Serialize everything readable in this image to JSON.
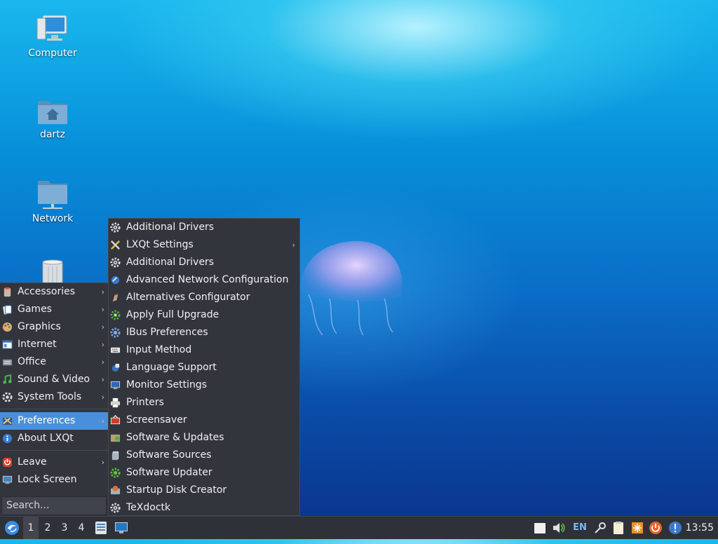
{
  "desktop": {
    "icons": [
      {
        "label": "Computer",
        "icon": "computer-icon"
      },
      {
        "label": "dartz",
        "icon": "home-folder-icon"
      },
      {
        "label": "Network",
        "icon": "network-folder-icon"
      },
      {
        "label": "",
        "icon": "trash-icon"
      }
    ]
  },
  "main_menu": {
    "categories": [
      {
        "label": "Accessories",
        "icon": "accessories-icon",
        "submenu": true
      },
      {
        "label": "Games",
        "icon": "games-icon",
        "submenu": true
      },
      {
        "label": "Graphics",
        "icon": "graphics-icon",
        "submenu": true
      },
      {
        "label": "Internet",
        "icon": "internet-icon",
        "submenu": true
      },
      {
        "label": "Office",
        "icon": "office-icon",
        "submenu": true
      },
      {
        "label": "Sound & Video",
        "icon": "sound-video-icon",
        "submenu": true
      },
      {
        "label": "System Tools",
        "icon": "system-tools-icon",
        "submenu": true
      }
    ],
    "preferences": {
      "label": "Preferences",
      "icon": "preferences-icon",
      "submenu": true,
      "active": true
    },
    "about": {
      "label": "About LXQt",
      "icon": "info-icon"
    },
    "leave": {
      "label": "Leave",
      "icon": "leave-icon",
      "submenu": true
    },
    "lock": {
      "label": "Lock Screen",
      "icon": "lock-screen-icon"
    },
    "search_placeholder": "Search..."
  },
  "preferences_menu": {
    "items": [
      {
        "label": "Additional Drivers",
        "icon": "gear-icon"
      },
      {
        "label": "LXQt Settings",
        "icon": "tools-icon",
        "submenu": true
      },
      {
        "label": "Additional Drivers",
        "icon": "gear-icon"
      },
      {
        "label": "Advanced Network Configuration",
        "icon": "network-config-icon"
      },
      {
        "label": "Alternatives Configurator",
        "icon": "alternatives-icon"
      },
      {
        "label": "Apply Full Upgrade",
        "icon": "upgrade-gear-icon"
      },
      {
        "label": "IBus Preferences",
        "icon": "ibus-gear-icon"
      },
      {
        "label": "Input Method",
        "icon": "keyboard-icon"
      },
      {
        "label": "Language Support",
        "icon": "language-icon"
      },
      {
        "label": "Monitor Settings",
        "icon": "monitor-icon"
      },
      {
        "label": "Printers",
        "icon": "printer-icon"
      },
      {
        "label": "Screensaver",
        "icon": "screensaver-icon"
      },
      {
        "label": "Software & Updates",
        "icon": "software-updates-icon"
      },
      {
        "label": "Software Sources",
        "icon": "software-sources-icon"
      },
      {
        "label": "Software Updater",
        "icon": "software-updater-icon"
      },
      {
        "label": "Startup Disk Creator",
        "icon": "startup-disk-icon"
      },
      {
        "label": "TeXdoctk",
        "icon": "gear-icon"
      }
    ]
  },
  "taskbar": {
    "workspaces": [
      "1",
      "2",
      "3",
      "4"
    ],
    "active_workspace": "1",
    "keyboard_layout": "EN",
    "clock": "13:55"
  },
  "colors": {
    "menu_bg": "#33353d",
    "highlight": "#4a90d9",
    "taskbar_bg": "#2f3138"
  }
}
